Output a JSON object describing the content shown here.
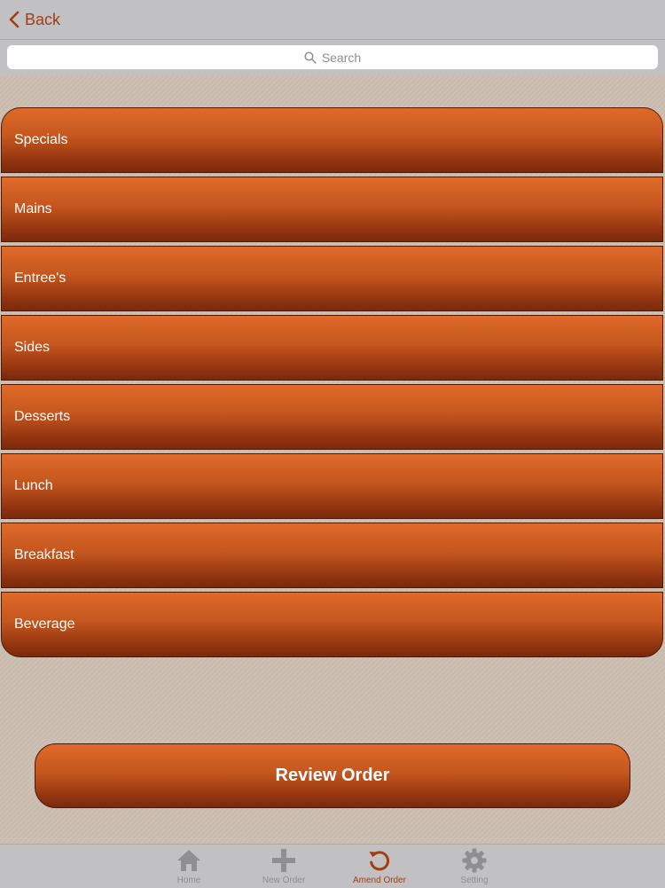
{
  "nav": {
    "back_label": "Back"
  },
  "search": {
    "placeholder": "Search"
  },
  "categories": [
    {
      "label": "Specials"
    },
    {
      "label": "Mains"
    },
    {
      "label": "Entree's"
    },
    {
      "label": "Sides"
    },
    {
      "label": "Desserts"
    },
    {
      "label": "Lunch"
    },
    {
      "label": "Breakfast"
    },
    {
      "label": "Beverage"
    }
  ],
  "review_button": {
    "label": "Review Order"
  },
  "tabs": [
    {
      "label": "Home",
      "icon": "home-icon",
      "active": false
    },
    {
      "label": "New Order",
      "icon": "plus-icon",
      "active": false
    },
    {
      "label": "Amend Order",
      "icon": "refresh-icon",
      "active": true
    },
    {
      "label": "Setting",
      "icon": "gear-icon",
      "active": false
    }
  ],
  "colors": {
    "accent": "#a33d12",
    "button_top": "#e06a2a",
    "button_bottom": "#7a2a0c",
    "bar_bg": "#c1c1c4",
    "page_bg": "#c9bcaf",
    "inactive_tab": "#8e8e93"
  }
}
